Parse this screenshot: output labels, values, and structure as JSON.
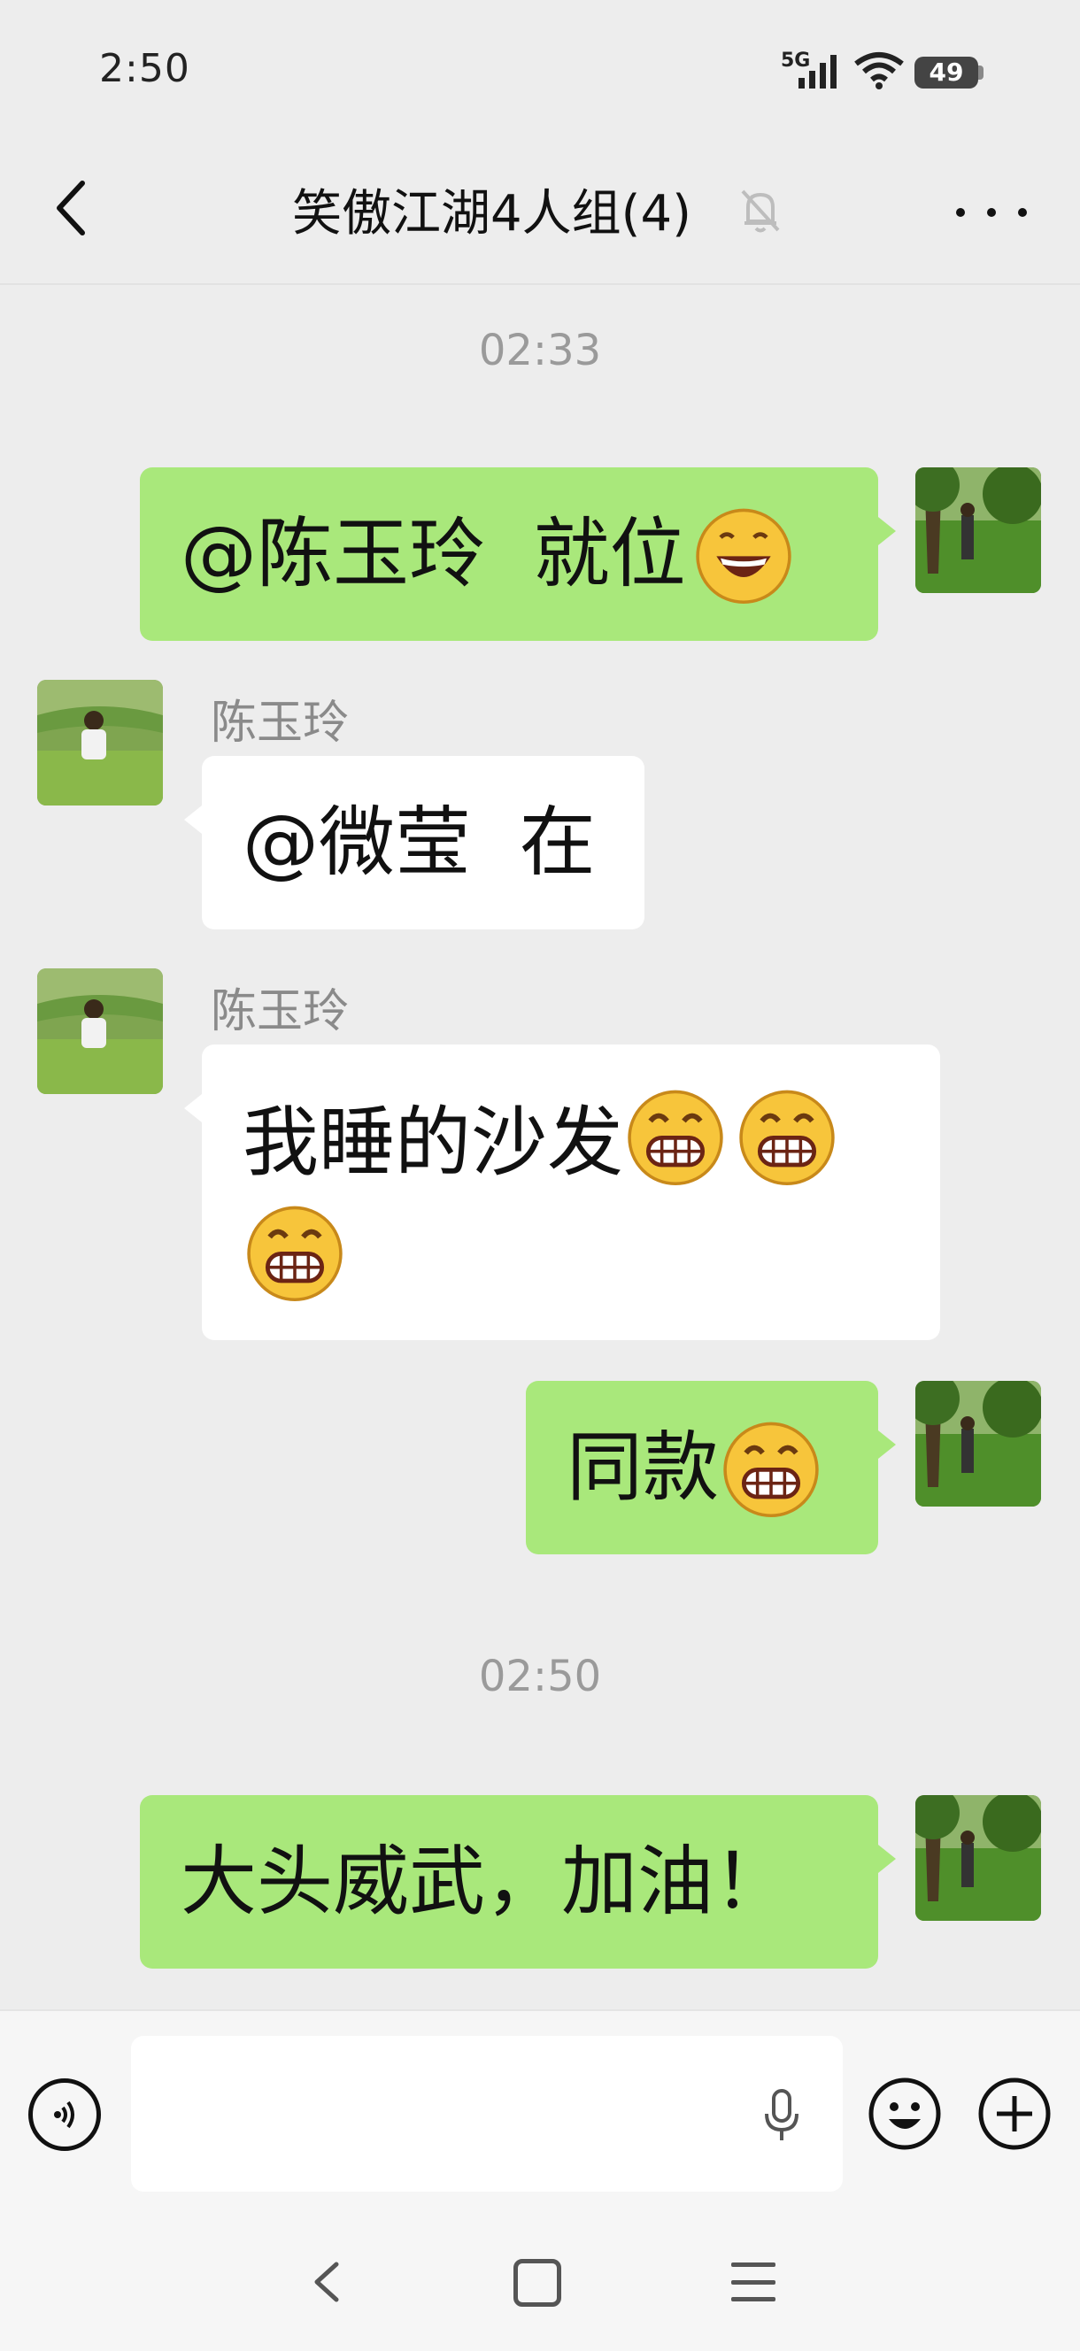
{
  "status_bar": {
    "time": "2:50",
    "network": "5G",
    "battery": "49"
  },
  "nav": {
    "title": "笑傲江湖4人组(4)"
  },
  "timestamps": [
    "02:33",
    "02:50"
  ],
  "messages": [
    {
      "side": "me",
      "text": "@陈玉玲  就位",
      "emoji": "grinning-face"
    },
    {
      "side": "other",
      "sender": "陈玉玲",
      "text": "@微莹  在"
    },
    {
      "side": "other",
      "sender": "陈玉玲",
      "line1": "我睡的沙发",
      "emoji": "beaming-face-with-smiling-eyes"
    },
    {
      "side": "me",
      "text": "同款",
      "emoji": "beaming-face-with-smiling-eyes"
    },
    {
      "side": "me",
      "text": "大头威武，加油！"
    }
  ],
  "input": {
    "placeholder": ""
  },
  "icons": {
    "back": "back-arrow-icon",
    "mute": "bell-off-icon",
    "more": "more-dots-icon",
    "voice": "voice-mode-icon",
    "mic": "microphone-icon",
    "emoji": "emoji-icon",
    "plus": "plus-icon"
  },
  "colors": {
    "my_bubble": "#a9e87b",
    "other_bubble": "#ffffff",
    "background": "#ededed"
  }
}
